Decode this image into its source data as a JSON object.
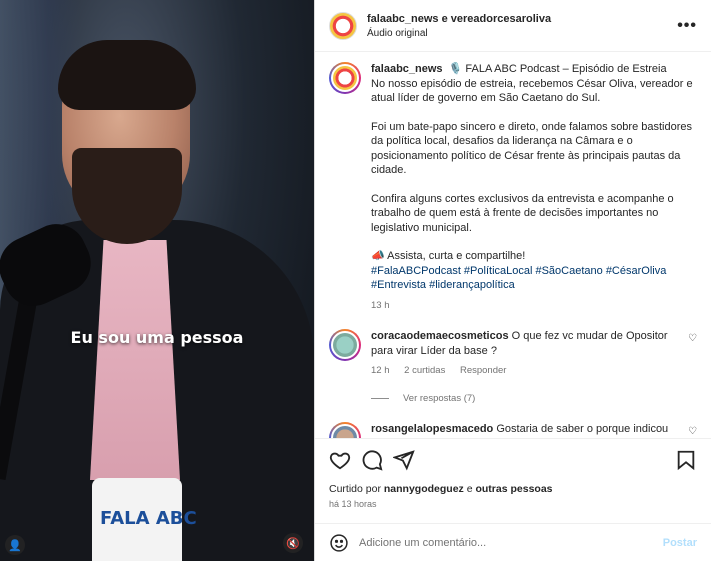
{
  "video": {
    "caption": "Eu sou uma pessoa",
    "mug_text": "FALA ABC"
  },
  "header": {
    "title": "falaabc_news e vereadorcesaroliva",
    "audio": "Áudio original",
    "more_icon": "more-horizontal-icon"
  },
  "post": {
    "username": "falaabc_news",
    "title_line": "🎙️ FALA ABC Podcast – Episódio de Estreia",
    "p1": "No nosso episódio de estreia, recebemos César Oliva, vereador e atual líder de governo em São Caetano do Sul.",
    "p2": "Foi um bate-papo sincero e direto, onde falamos sobre bastidores da política local, desafios da liderança na Câmara e o posicionamento político de César frente às principais pautas da cidade.",
    "p3": "Confira alguns cortes exclusivos da entrevista e acompanhe o trabalho de quem está à frente de decisões importantes no legislativo municipal.",
    "p4": "📣 Assista, curta e compartilhe!",
    "hashtags": "#FalaABCPodcast #PolíticaLocal #SãoCaetano #CésarOliva #Entrevista #liderançapolítica",
    "time": "13 h"
  },
  "comments": [
    {
      "username": "coracaodemaecosmeticos",
      "text": "O que fez vc mudar de Opositor para virar Líder da base ?",
      "time": "12 h",
      "likes": "2 curtidas",
      "reply": "Responder",
      "view_replies": "Ver respostas (7)"
    },
    {
      "username": "rosangelalopesmacedo",
      "text": "Gostaria de saber o porque indicou"
    }
  ],
  "actions": {
    "liked_by_prefix": "Curtido por ",
    "liked_by_user": "nannygodeguez",
    "liked_by_suffix": " e ",
    "liked_by_others": "outras pessoas",
    "time_ago": "há 13 horas"
  },
  "comment_input": {
    "placeholder": "Adicione um comentário...",
    "post_label": "Postar"
  }
}
